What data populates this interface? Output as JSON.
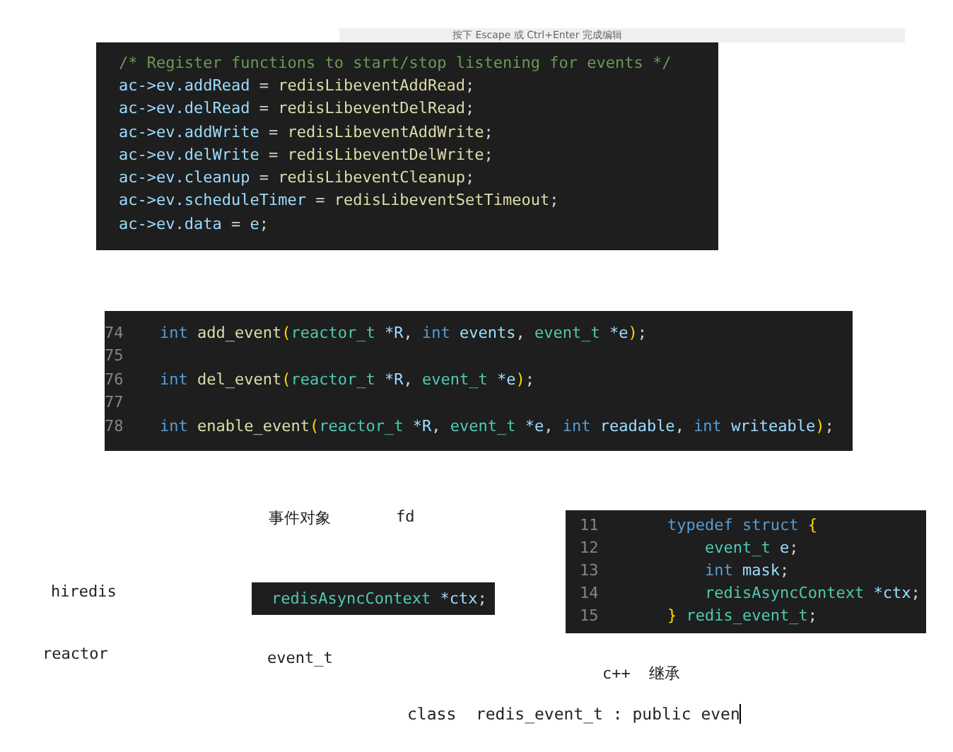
{
  "hint": "按下 Escape 或 Ctrl+Enter 完成编辑",
  "items": [
    {
      "kind": "code",
      "lines": [
        {
          "segments": [
            {
              "kind": "comment",
              "t": "/* Register functions to start/stop listening for events */"
            }
          ]
        },
        {
          "segments": [
            {
              "kind": "var",
              "t": "ac->ev.addRead"
            },
            {
              "kind": "punct",
              "t": " = "
            },
            {
              "kind": "func",
              "t": "redisLibeventAddRead"
            },
            {
              "kind": "punct",
              "t": ";"
            }
          ]
        },
        {
          "segments": [
            {
              "kind": "var",
              "t": "ac->ev.delRead"
            },
            {
              "kind": "punct",
              "t": " = "
            },
            {
              "kind": "func",
              "t": "redisLibeventDelRead"
            },
            {
              "kind": "punct",
              "t": ";"
            }
          ]
        },
        {
          "segments": [
            {
              "kind": "var",
              "t": "ac->ev.addWrite"
            },
            {
              "kind": "punct",
              "t": " = "
            },
            {
              "kind": "func",
              "t": "redisLibeventAddWrite"
            },
            {
              "kind": "punct",
              "t": ";"
            }
          ]
        },
        {
          "segments": [
            {
              "kind": "var",
              "t": "ac->ev.delWrite"
            },
            {
              "kind": "punct",
              "t": " = "
            },
            {
              "kind": "func",
              "t": "redisLibeventDelWrite"
            },
            {
              "kind": "punct",
              "t": ";"
            }
          ]
        },
        {
          "segments": [
            {
              "kind": "var",
              "t": "ac->ev.cleanup"
            },
            {
              "kind": "punct",
              "t": " = "
            },
            {
              "kind": "func",
              "t": "redisLibeventCleanup"
            },
            {
              "kind": "punct",
              "t": ";"
            }
          ]
        },
        {
          "segments": [
            {
              "kind": "var",
              "t": "ac->ev.scheduleTimer"
            },
            {
              "kind": "punct",
              "t": " = "
            },
            {
              "kind": "func",
              "t": "redisLibeventSetTimeout"
            },
            {
              "kind": "punct",
              "t": ";"
            }
          ]
        },
        {
          "segments": [
            {
              "kind": "var",
              "t": "ac->ev.data"
            },
            {
              "kind": "punct",
              "t": " = "
            },
            {
              "kind": "var",
              "t": "e"
            },
            {
              "kind": "punct",
              "t": ";"
            }
          ]
        }
      ]
    },
    {
      "kind": "code",
      "lines": [
        {
          "number": "74",
          "segments": [
            {
              "kind": "kw",
              "t": "int "
            },
            {
              "kind": "func",
              "t": "add_event"
            },
            {
              "kind": "bracket",
              "t": "("
            },
            {
              "kind": "type",
              "t": "reactor_t "
            },
            {
              "kind": "var",
              "t": "*R"
            },
            {
              "kind": "punct",
              "t": ", "
            },
            {
              "kind": "kw",
              "t": "int "
            },
            {
              "kind": "var",
              "t": "events"
            },
            {
              "kind": "punct",
              "t": ", "
            },
            {
              "kind": "type",
              "t": "event_t "
            },
            {
              "kind": "var",
              "t": "*e"
            },
            {
              "kind": "bracket",
              "t": ")"
            },
            {
              "kind": "punct",
              "t": ";"
            }
          ]
        },
        {
          "number": "75"
        },
        {
          "number": "76",
          "segments": [
            {
              "kind": "kw",
              "t": "int "
            },
            {
              "kind": "func",
              "t": "del_event"
            },
            {
              "kind": "bracket",
              "t": "("
            },
            {
              "kind": "type",
              "t": "reactor_t "
            },
            {
              "kind": "var",
              "t": "*R"
            },
            {
              "kind": "punct",
              "t": ", "
            },
            {
              "kind": "type",
              "t": "event_t "
            },
            {
              "kind": "var",
              "t": "*e"
            },
            {
              "kind": "bracket",
              "t": ")"
            },
            {
              "kind": "punct",
              "t": ";"
            }
          ]
        },
        {
          "number": "77"
        },
        {
          "number": "78",
          "segments": [
            {
              "kind": "kw",
              "t": "int "
            },
            {
              "kind": "func",
              "t": "enable_event"
            },
            {
              "kind": "bracket",
              "t": "("
            },
            {
              "kind": "type",
              "t": "reactor_t "
            },
            {
              "kind": "var",
              "t": "*R"
            },
            {
              "kind": "punct",
              "t": ", "
            },
            {
              "kind": "type",
              "t": "event_t "
            },
            {
              "kind": "var",
              "t": "*e"
            },
            {
              "kind": "punct",
              "t": ", "
            },
            {
              "kind": "kw",
              "t": "int "
            },
            {
              "kind": "var",
              "t": "readable"
            },
            {
              "kind": "punct",
              "t": ", "
            },
            {
              "kind": "kw",
              "t": "int "
            },
            {
              "kind": "var",
              "t": "writeable"
            },
            {
              "kind": "bracket",
              "t": ")"
            },
            {
              "kind": "punct",
              "t": ";"
            }
          ]
        }
      ]
    },
    {
      "kind": "note",
      "text": "事件对象"
    },
    {
      "kind": "note",
      "text": "fd"
    },
    {
      "kind": "code",
      "lines": [
        {
          "number": "11",
          "segments": [
            {
              "kind": "kw",
              "t": "typedef struct "
            },
            {
              "kind": "bracket",
              "t": "{"
            }
          ]
        },
        {
          "number": "12",
          "segments": [
            {
              "kind": "type",
              "t": "    event_t "
            },
            {
              "kind": "var",
              "t": "e"
            },
            {
              "kind": "punct",
              "t": ";"
            }
          ]
        },
        {
          "number": "13",
          "segments": [
            {
              "kind": "kw",
              "t": "    int "
            },
            {
              "kind": "var",
              "t": "mask"
            },
            {
              "kind": "punct",
              "t": ";"
            }
          ]
        },
        {
          "number": "14",
          "segments": [
            {
              "kind": "type",
              "t": "    redisAsyncContext "
            },
            {
              "kind": "var",
              "t": "*ctx"
            },
            {
              "kind": "punct",
              "t": ";"
            }
          ]
        },
        {
          "number": "15",
          "segments": [
            {
              "kind": "bracket",
              "t": "} "
            },
            {
              "kind": "type",
              "t": "redis_event_t"
            },
            {
              "kind": "punct",
              "t": ";"
            }
          ]
        }
      ]
    },
    {
      "kind": "note",
      "text": "hiredis"
    },
    {
      "kind": "code",
      "lines": [
        {
          "segments": [
            {
              "kind": "type",
              "t": "redisAsyncContext "
            },
            {
              "kind": "var",
              "t": "*ctx"
            },
            {
              "kind": "punct",
              "t": ";"
            }
          ]
        }
      ]
    },
    {
      "kind": "note",
      "text": "reactor"
    },
    {
      "kind": "note",
      "text": "event_t"
    },
    {
      "kind": "note",
      "text": "c++  继承"
    },
    {
      "kind": "input",
      "text": "class  redis_event_t : public even"
    }
  ]
}
